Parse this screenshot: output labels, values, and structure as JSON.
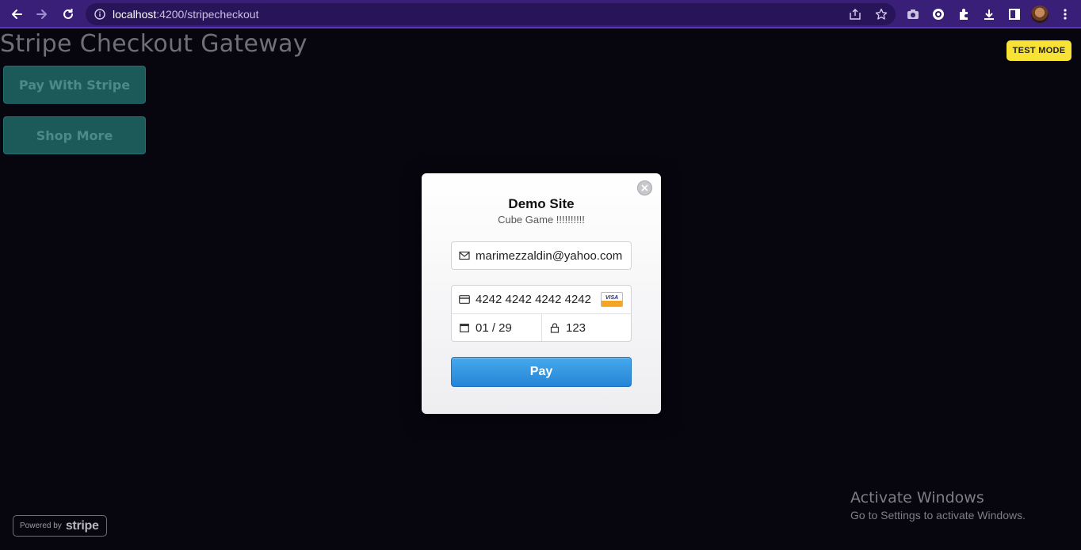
{
  "browser": {
    "url_host": "localhost",
    "url_path": ":4200/stripecheckout",
    "icons": [
      "back-icon",
      "forward-icon",
      "reload-icon",
      "info-icon",
      "share-icon",
      "star-icon",
      "camera-icon",
      "extension-icon",
      "puzzle-icon",
      "download-icon",
      "sidepanel-icon",
      "avatar",
      "menu-icon"
    ]
  },
  "page": {
    "title": "Stripe Checkout Gateway",
    "buttons": [
      "Pay With Stripe",
      "Shop More"
    ],
    "test_mode": "TEST MODE"
  },
  "modal": {
    "title": "Demo Site",
    "subtitle": "Cube Game !!!!!!!!!!",
    "email": "marimezzaldin@yahoo.com",
    "card_number": "4242 4242 4242 4242",
    "card_brand": "VISA",
    "expiry": "01 / 29",
    "cvc": "123",
    "pay_label": "Pay"
  },
  "footer": {
    "powered_by": "Powered by",
    "brand": "stripe"
  },
  "watermark": {
    "line1": "Activate Windows",
    "line2": "Go to Settings to activate Windows."
  },
  "colors": {
    "chrome": "#3a1f78",
    "page_bg": "#07060f",
    "accent_pay": "#2f8fe0",
    "test_mode": "#f7e235"
  }
}
